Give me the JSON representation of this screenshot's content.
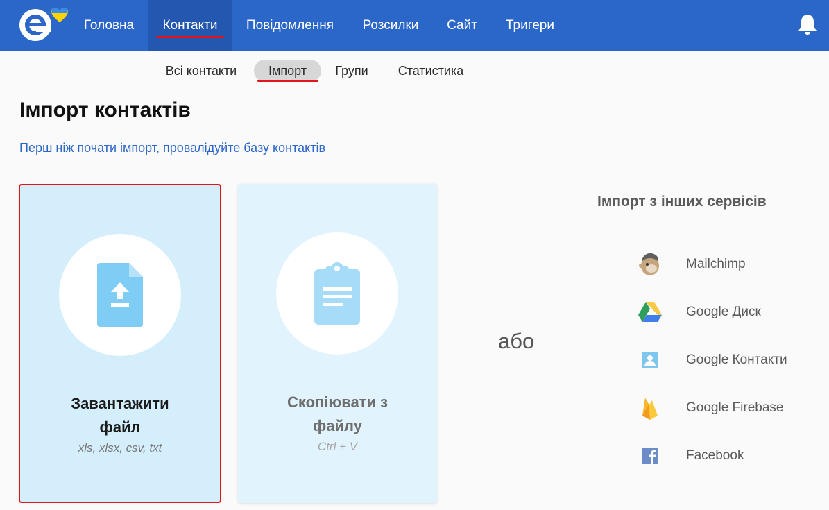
{
  "nav": {
    "items": [
      {
        "label": "Головна"
      },
      {
        "label": "Контакти"
      },
      {
        "label": "Повідомлення"
      },
      {
        "label": "Розсилки"
      },
      {
        "label": "Сайт"
      },
      {
        "label": "Тригери"
      }
    ],
    "active": "Контакти"
  },
  "subnav": {
    "items": [
      {
        "label": "Всі контакти"
      },
      {
        "label": "Імпорт"
      },
      {
        "label": "Групи"
      },
      {
        "label": "Статистика"
      }
    ],
    "active": "Імпорт"
  },
  "page": {
    "title": "Імпорт контактів",
    "validate_link": "Перш ніж почати імпорт, провалідуйте базу контактів"
  },
  "cards": {
    "upload": {
      "title_line1": "Завантажити",
      "title_line2": "файл",
      "subtitle": "xls, xlsx, csv, txt",
      "icon": "file-upload-icon"
    },
    "copy": {
      "title_line1": "Скопіювати з",
      "title_line2": "файлу",
      "subtitle": "Ctrl + V",
      "icon": "clipboard-icon"
    }
  },
  "or_text": "або",
  "services": {
    "title": "Імпорт з інших сервісів",
    "items": [
      {
        "label": "Mailchimp",
        "icon": "mailchimp-icon"
      },
      {
        "label": "Google Диск",
        "icon": "google-drive-icon"
      },
      {
        "label": "Google Контакти",
        "icon": "google-contacts-icon"
      },
      {
        "label": "Google Firebase",
        "icon": "firebase-icon"
      },
      {
        "label": "Facebook",
        "icon": "facebook-icon"
      }
    ]
  },
  "colors": {
    "nav_bg": "#2b66c9",
    "nav_active_bg": "#2457b0",
    "accent_red": "#e3141b",
    "link_blue": "#2b66c9",
    "card_upload_bg": "#d4eefc",
    "card_copy_bg": "#e1f3fd",
    "icon_blue": "#7fcdf5"
  }
}
